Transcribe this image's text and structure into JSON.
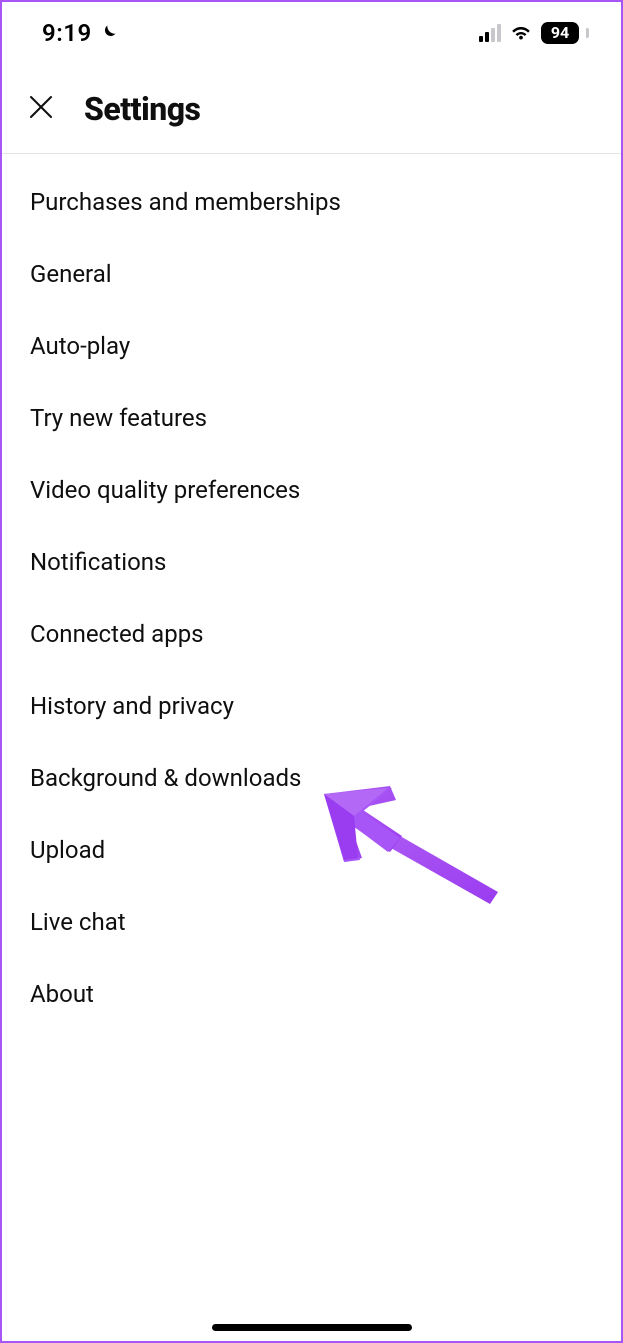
{
  "status_bar": {
    "time": "9:19",
    "battery_percent": "94"
  },
  "header": {
    "title": "Settings"
  },
  "settings": {
    "items": [
      {
        "label": "Purchases and memberships"
      },
      {
        "label": "General"
      },
      {
        "label": "Auto-play"
      },
      {
        "label": "Try new features"
      },
      {
        "label": "Video quality preferences"
      },
      {
        "label": "Notifications"
      },
      {
        "label": "Connected apps"
      },
      {
        "label": "History and privacy"
      },
      {
        "label": "Background & downloads"
      },
      {
        "label": "Upload"
      },
      {
        "label": "Live chat"
      },
      {
        "label": "About"
      }
    ]
  },
  "annotation": {
    "target": "Background & downloads",
    "color": "#a855f7"
  }
}
